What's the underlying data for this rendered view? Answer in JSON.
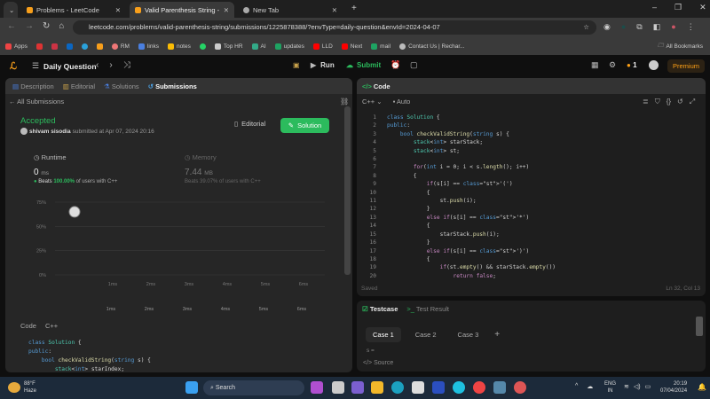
{
  "browser": {
    "tabs": [
      {
        "label": "Problems - LeetCode"
      },
      {
        "label": "Valid Parenthesis String - LeetC"
      },
      {
        "label": "New Tab"
      }
    ],
    "url": "leetcode.com/problems/valid-parenthesis-string/submissions/1225878388/?envType=daily-question&envId=2024-04-07",
    "bookmarks": [
      "Apps",
      "RM",
      "links",
      "notes",
      "Top HR",
      "AI",
      "updates",
      "LLD",
      "Next",
      "mail",
      "Contact Us | Rechar..."
    ],
    "all_bookmarks": "All Bookmarks"
  },
  "nav": {
    "title": "Daily Question",
    "run": "Run",
    "submit": "Submit",
    "streak": "1",
    "premium": "Premium"
  },
  "left": {
    "tabs": [
      "Description",
      "Editorial",
      "Solutions",
      "Submissions"
    ],
    "back": "All Submissions",
    "status": "Accepted",
    "user": "shivam sisodia",
    "submitted": "submitted at Apr 07, 2024 20:16",
    "editorial": "Editorial",
    "solution": "Solution",
    "runtime": {
      "label": "Runtime",
      "value": "0",
      "unit": "ms",
      "beats_pre": "Beats",
      "beats": "100.00%",
      "beats_post": "of users with C++"
    },
    "memory": {
      "label": "Memory",
      "value": "7.44",
      "unit": "MB",
      "beats_pre": "Beats",
      "beats": "39.07%",
      "beats_post": "of users with C++"
    },
    "code_label": "Code",
    "lang": "C++",
    "code": [
      "class Solution {",
      "public:",
      "    bool checkValidString(string s) {",
      "        stack<int> starIndex;"
    ]
  },
  "chart_data": {
    "type": "scatter",
    "y_ticks": [
      "75%",
      "50%",
      "25%",
      "0%"
    ],
    "x_ticks": [
      "1ms",
      "2ms",
      "3ms",
      "4ms",
      "5ms",
      "6ms"
    ],
    "ylim": [
      0,
      75
    ],
    "point": {
      "x": 0,
      "y": 65
    }
  },
  "right": {
    "title": "Code",
    "lang": "C++",
    "mode": "Auto",
    "saved": "Saved",
    "cursor": "Ln 32, Col 13",
    "lines": [
      "class Solution {",
      "public:",
      "    bool checkValidString(string s) {",
      "        stack<int> starStack;",
      "        stack<int> st;",
      "",
      "        for(int i = 0; i < s.length(); i++)",
      "        {",
      "            if(s[i] == '(')",
      "            {",
      "                st.push(i);",
      "            }",
      "            else if(s[i] == '*')",
      "            {",
      "                starStack.push(i);",
      "            }",
      "            else if(s[i] == ')')",
      "            {",
      "                if(st.empty() && starStack.empty())",
      "                    return false;"
    ]
  },
  "testcase": {
    "tab": "Testcase",
    "result_tab": "Test Result",
    "cases": [
      "Case 1",
      "Case 2",
      "Case 3"
    ],
    "add": "+",
    "var": "s =",
    "source": "Source"
  },
  "taskbar": {
    "temp": "88°F",
    "weather": "Haze",
    "search": "Search",
    "lang1": "ENG",
    "lang2": "IN",
    "time": "20:19",
    "date": "07/04/2024"
  }
}
